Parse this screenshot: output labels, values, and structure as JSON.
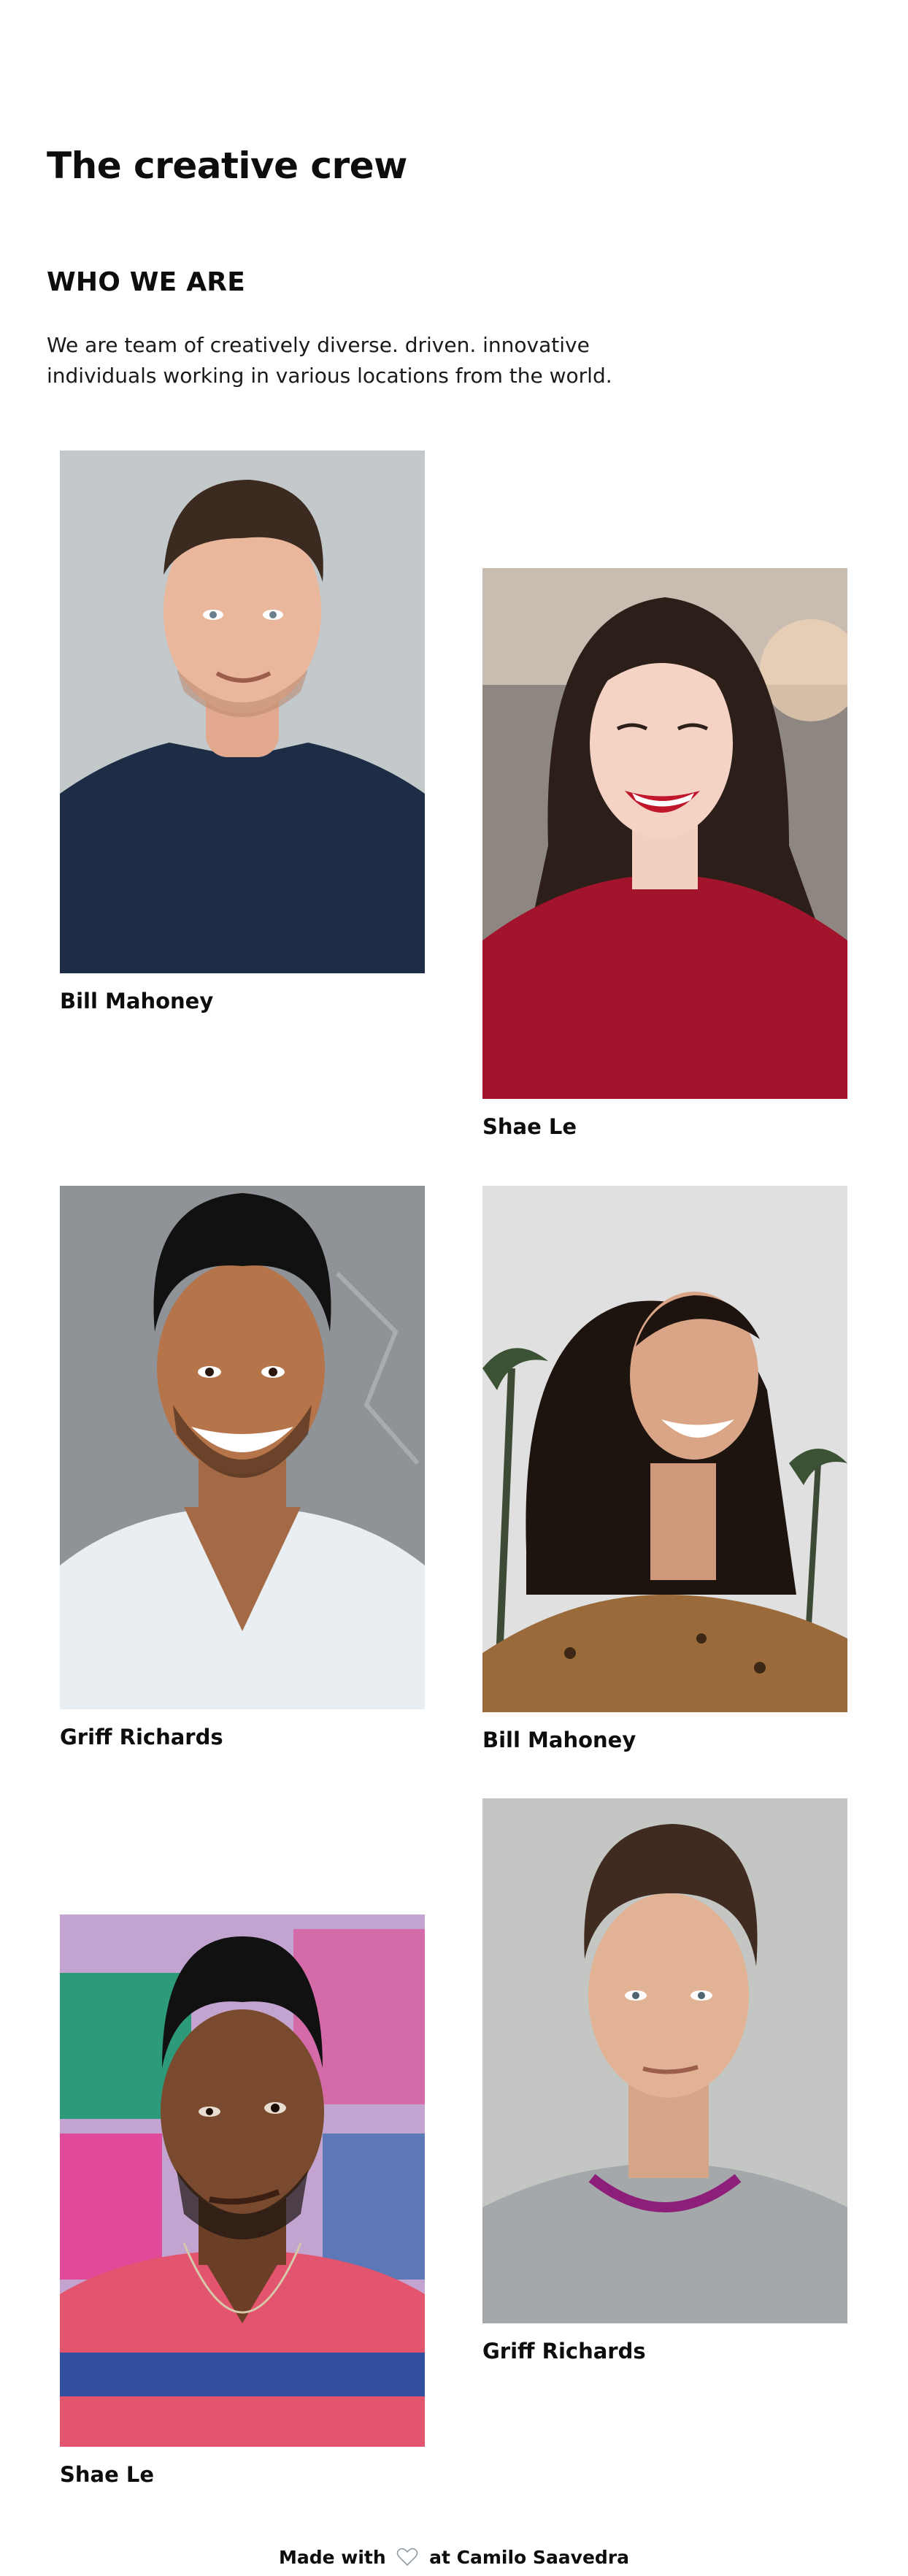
{
  "page": {
    "title": "The creative crew",
    "section_heading": "WHO WE ARE",
    "intro_text": "We are team of creatively diverse. driven. innovative individuals working in various locations from the world."
  },
  "team": [
    {
      "name": "Bill Mahoney"
    },
    {
      "name": "Shae Le"
    },
    {
      "name": "Griff Richards"
    },
    {
      "name": "Bill Mahoney"
    },
    {
      "name": "Shae Le"
    },
    {
      "name": "Griff Richards"
    }
  ],
  "footer": {
    "prefix": "Made with",
    "icon": "heart-icon",
    "suffix": "at Camilo Saavedra"
  }
}
